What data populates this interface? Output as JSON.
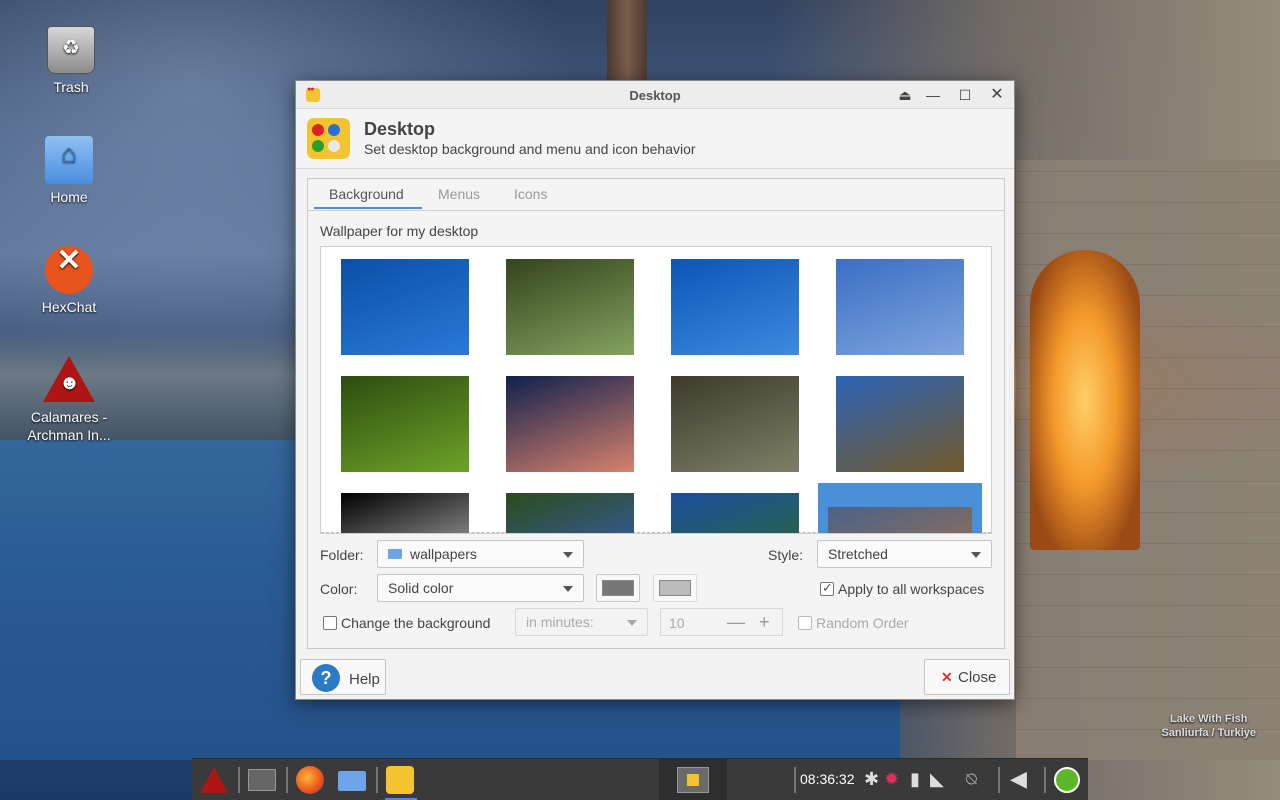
{
  "desktop": {
    "icons": [
      {
        "label": "Trash"
      },
      {
        "label": "Home"
      },
      {
        "label": "HexChat"
      },
      {
        "label": "Calamares - Archman In..."
      }
    ],
    "wallpaper_caption_line1": "Lake With Fish",
    "wallpaper_caption_line2": "Sanliurfa / Turkiye"
  },
  "window": {
    "title": "Desktop",
    "header_title": "Desktop",
    "header_subtitle": "Set desktop background and menu and icon behavior",
    "tabs": [
      {
        "label": "Background",
        "active": true
      },
      {
        "label": "Menus",
        "active": false
      },
      {
        "label": "Icons",
        "active": false
      }
    ],
    "wallpaper_label": "Wallpaper for my desktop",
    "thumbnails": [
      {
        "name": "blue-abstract-1",
        "colors": [
          "#0b4fa8",
          "#2a7ad6"
        ]
      },
      {
        "name": "butterfly",
        "colors": [
          "#33451d",
          "#86a160"
        ]
      },
      {
        "name": "blue-abstract-2",
        "colors": [
          "#0b56b5",
          "#3d8ae0"
        ]
      },
      {
        "name": "bird-on-wire",
        "colors": [
          "#3b6fc4",
          "#7ea4dd"
        ]
      },
      {
        "name": "forest-pond",
        "colors": [
          "#2c4d10",
          "#6fa228"
        ]
      },
      {
        "name": "flower",
        "colors": [
          "#10204e",
          "#d8826c"
        ]
      },
      {
        "name": "squirrel",
        "colors": [
          "#3d3a2c",
          "#7d8066"
        ]
      },
      {
        "name": "tree-field",
        "colors": [
          "#2d64b7",
          "#725a2a"
        ]
      },
      {
        "name": "wire-sphere",
        "colors": [
          "#000000",
          "#cccccc"
        ]
      },
      {
        "name": "blue-flowers",
        "colors": [
          "#2b4c1a",
          "#3a60cc"
        ]
      },
      {
        "name": "leaf-sky",
        "colors": [
          "#1c4f9e",
          "#2d6b24"
        ]
      },
      {
        "name": "lake-with-fish",
        "colors": [
          "#4a6288",
          "#b07640"
        ],
        "selected": true
      }
    ],
    "folder_label": "Folder:",
    "folder_value": "wallpapers",
    "style_label": "Style:",
    "style_value": "Stretched",
    "color_label": "Color:",
    "color_value": "Solid color",
    "color_primary": "#777777",
    "color_secondary": "#bcbcbc",
    "apply_all_label": "Apply to all workspaces",
    "apply_all_checked": true,
    "change_bg_label": "Change the background",
    "change_bg_checked": false,
    "interval_unit": "in minutes:",
    "interval_value": "10",
    "random_order_label": "Random Order",
    "help_label": "Help",
    "close_label": "Close"
  },
  "taskbar": {
    "clock": "08:36:32"
  }
}
